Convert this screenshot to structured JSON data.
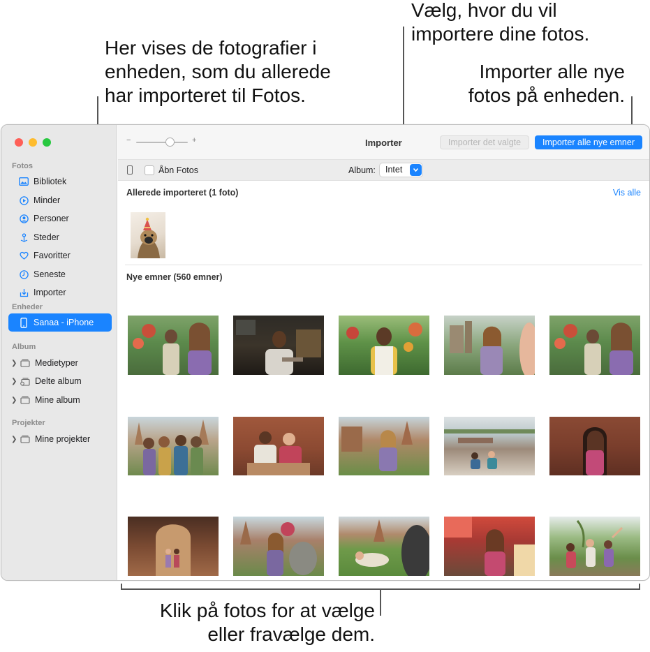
{
  "callouts": {
    "already_imported": [
      "Her vises de fotografier i",
      "enheden, som du allerede",
      "har importeret til Fotos."
    ],
    "choose_destination": [
      "Vælg, hvor du vil",
      "importere dine fotos."
    ],
    "import_all": [
      "Importer alle nye",
      "fotos på enheden."
    ],
    "click_photos": [
      "Klik på fotos for at vælge",
      "eller fravælge dem."
    ]
  },
  "sidebar": {
    "sections": [
      "Fotos",
      "Enheder",
      "Album",
      "Projekter"
    ],
    "fotos_items": [
      {
        "label": "Bibliotek",
        "icon": "photo-library-icon"
      },
      {
        "label": "Minder",
        "icon": "memories-icon"
      },
      {
        "label": "Personer",
        "icon": "people-icon"
      },
      {
        "label": "Steder",
        "icon": "places-pin-icon"
      },
      {
        "label": "Favoritter",
        "icon": "heart-icon"
      },
      {
        "label": "Seneste",
        "icon": "clock-icon"
      },
      {
        "label": "Importer",
        "icon": "import-icon"
      }
    ],
    "device_item": {
      "label": "Sanaa - iPhone",
      "icon": "iphone-icon"
    },
    "album_items": [
      {
        "label": "Medietyper",
        "icon": "folder-stack-icon"
      },
      {
        "label": "Delte album",
        "icon": "shared-album-icon"
      },
      {
        "label": "Mine album",
        "icon": "folder-stack-icon"
      }
    ],
    "project_items": [
      {
        "label": "Mine projekter",
        "icon": "folder-stack-icon"
      }
    ]
  },
  "toolbar": {
    "zoom_minus": "−",
    "zoom_plus": "+",
    "zoom_level": 0.65,
    "title": "Importer",
    "import_selected_label": "Importer det valgte",
    "import_all_label": "Importer alle nye emner"
  },
  "importbar": {
    "open_photos_label": "Åbn Fotos",
    "open_photos_checked": false,
    "album_label": "Album:",
    "album_value": "Intet"
  },
  "content": {
    "already_heading": "Allerede importeret (1 foto)",
    "show_all": "Vis alle",
    "new_heading": "Nye emner (560 emner)"
  },
  "colors": {
    "accent": "#1a84ff",
    "sidebar_bg": "#e8e8e8",
    "traffic_red": "#fe5f57",
    "traffic_yellow": "#febc2e",
    "traffic_green": "#28c840"
  }
}
